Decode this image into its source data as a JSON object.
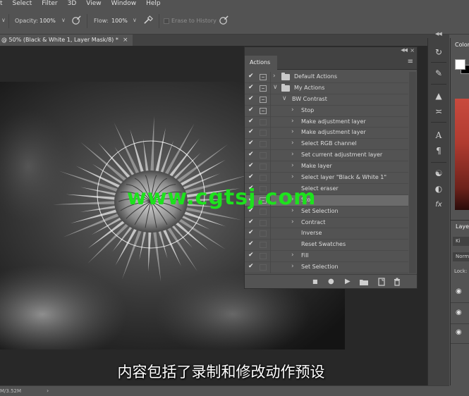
{
  "menubar": {
    "items": [
      "t",
      "Select",
      "Filter",
      "3D",
      "View",
      "Window",
      "Help"
    ]
  },
  "options": {
    "opacity_label": "Opacity:",
    "opacity_value": "100%",
    "flow_label": "Flow:",
    "flow_value": "100%",
    "erase_history_label": "Erase to History"
  },
  "document": {
    "tab_title": "@ 50% (Black & White 1, Layer Mask/8) *",
    "close_glyph": "×"
  },
  "status": {
    "doc_size": "M/3.52M"
  },
  "actions_panel": {
    "tab_label": "Actions",
    "rows": [
      {
        "label": "Default Actions",
        "level": 0,
        "kind": "set",
        "expanded": false,
        "dialog": true
      },
      {
        "label": "My Actions",
        "level": 0,
        "kind": "set",
        "expanded": true,
        "dialog": true
      },
      {
        "label": "BW Contrast",
        "level": 1,
        "kind": "action",
        "expanded": true,
        "dialog": true
      },
      {
        "label": "Stop",
        "level": 2,
        "kind": "step",
        "expanded": false,
        "dialog": true
      },
      {
        "label": "Make adjustment layer",
        "level": 2,
        "kind": "step",
        "expanded": false,
        "dialog": false
      },
      {
        "label": "Make adjustment layer",
        "level": 2,
        "kind": "step",
        "expanded": false,
        "dialog": false
      },
      {
        "label": "Select RGB channel",
        "level": 2,
        "kind": "step",
        "expanded": false,
        "dialog": false
      },
      {
        "label": "Set current adjustment layer",
        "level": 2,
        "kind": "step",
        "expanded": false,
        "dialog": false
      },
      {
        "label": "Make layer",
        "level": 2,
        "kind": "step",
        "expanded": false,
        "dialog": false
      },
      {
        "label": "Select layer \"Black & White 1\"",
        "level": 2,
        "kind": "step",
        "expanded": false,
        "dialog": false
      },
      {
        "label": "Select eraser",
        "level": 2,
        "kind": "leaf",
        "expanded": false,
        "dialog": false
      },
      {
        "label": "Stop",
        "level": 2,
        "kind": "step",
        "expanded": false,
        "dialog": true,
        "selected": true
      },
      {
        "label": "Set Selection",
        "level": 2,
        "kind": "step",
        "expanded": false,
        "dialog": false
      },
      {
        "label": "Contract",
        "level": 2,
        "kind": "step",
        "expanded": false,
        "dialog": false
      },
      {
        "label": "Inverse",
        "level": 2,
        "kind": "leaf",
        "expanded": false,
        "dialog": false
      },
      {
        "label": "Reset Swatches",
        "level": 2,
        "kind": "leaf",
        "expanded": false,
        "dialog": false
      },
      {
        "label": "Fill",
        "level": 2,
        "kind": "step",
        "expanded": false,
        "dialog": false
      },
      {
        "label": "Set Selection",
        "level": 2,
        "kind": "step",
        "expanded": false,
        "dialog": false
      }
    ]
  },
  "right_panels": {
    "color_tab_label": "Color",
    "layers_tab_label": "Layer",
    "kind_label": "Ki",
    "blend_label": "Norm",
    "lock_label": "Lock:"
  },
  "overlay": {
    "watermark": "www.cgtsj.com",
    "subtitle": "内容包括了录制和修改动作预设"
  },
  "colors": {
    "accent_watermark": "#1de21d",
    "panel_bg": "#535353",
    "panel_dark": "#424242"
  }
}
